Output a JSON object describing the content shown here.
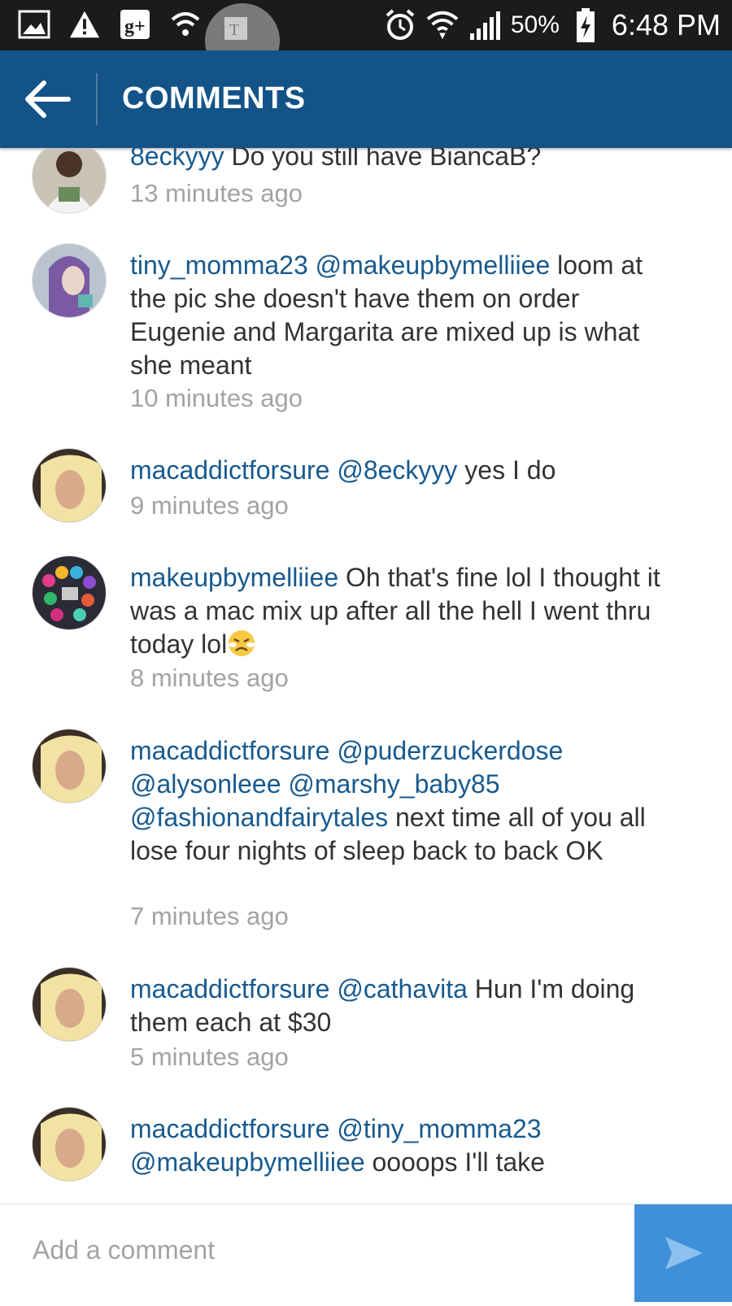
{
  "status_bar": {
    "battery": "50%",
    "time": "6:48 PM",
    "icons_left": [
      "gallery-icon",
      "warning-icon",
      "google-plus-icon",
      "wifi-icon",
      "t-mobile-icon"
    ],
    "icons_right": [
      "alarm-icon",
      "wifi-signal-icon",
      "cell-signal-icon",
      "battery-charging-icon"
    ]
  },
  "header": {
    "title": "COMMENTS",
    "back_icon": "back-arrow-icon"
  },
  "comments": [
    {
      "user": "8eckyyy",
      "segments": [
        {
          "t": " Do you still have BiancaB?",
          "m": false
        }
      ],
      "time": "13 minutes ago"
    },
    {
      "user": "tiny_momma23",
      "segments": [
        {
          "t": " ",
          "m": false
        },
        {
          "t": "@makeupbymelliiee",
          "m": true
        },
        {
          "t": " loom at the pic she doesn't have them on order Eugenie and Margarita are mixed up is what she meant",
          "m": false
        }
      ],
      "time": "10 minutes ago"
    },
    {
      "user": "macaddictforsure",
      "segments": [
        {
          "t": " ",
          "m": false
        },
        {
          "t": "@8eckyyy",
          "m": true
        },
        {
          "t": " yes I do",
          "m": false
        }
      ],
      "time": "9 minutes ago"
    },
    {
      "user": "makeupbymelliiee",
      "segments": [
        {
          "t": " Oh that's fine lol I thought it was a mac mix up after all the hell I went thru today lol",
          "m": false
        }
      ],
      "emoji": "persevering-face-emoji",
      "time": "8 minutes ago"
    },
    {
      "user": "macaddictforsure",
      "segments": [
        {
          "t": " ",
          "m": false
        },
        {
          "t": "@puderzuckerdose",
          "m": true
        },
        {
          "t": " ",
          "m": false
        },
        {
          "t": "@alysonleee",
          "m": true
        },
        {
          "t": " ",
          "m": false
        },
        {
          "t": "@marshy_baby85",
          "m": true
        },
        {
          "t": " ",
          "m": false
        },
        {
          "t": "@fashionandfairytales",
          "m": true
        },
        {
          "t": " next time all of you all lose four nights of sleep back to back OK",
          "m": false
        }
      ],
      "time": "7 minutes ago"
    },
    {
      "user": "macaddictforsure",
      "segments": [
        {
          "t": " ",
          "m": false
        },
        {
          "t": "@cathavita",
          "m": true
        },
        {
          "t": " Hun I'm doing them each at $30",
          "m": false
        }
      ],
      "time": "5 minutes ago"
    },
    {
      "user": "macaddictforsure",
      "segments": [
        {
          "t": " ",
          "m": false
        },
        {
          "t": "@tiny_momma23",
          "m": true
        },
        {
          "t": " ",
          "m": false
        },
        {
          "t": "@makeupbymelliiee",
          "m": true
        },
        {
          "t": " oooops I'll take",
          "m": false
        }
      ],
      "time": ""
    }
  ],
  "composer": {
    "placeholder": "Add a comment",
    "send_icon": "send-arrow-icon"
  },
  "colors": {
    "header": "#135388",
    "link": "#175a8f",
    "send": "#3f8fd9",
    "timestamp": "#a3a3a3"
  }
}
